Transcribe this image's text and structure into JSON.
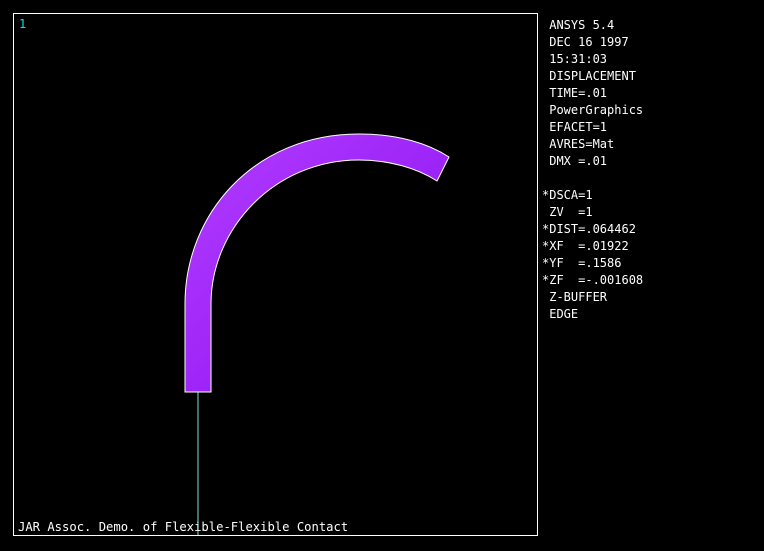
{
  "viewport": {
    "window_number": "1",
    "caption": "JAR Assoc. Demo. of Flexible-Flexible Contact"
  },
  "colors": {
    "background": "#000000",
    "frame": "#ffffff",
    "beam_fill": "#9a1aff",
    "beam_edge": "#ffffff",
    "target_line": "#7fe0e0",
    "window_number": "#00e5e5"
  },
  "legend": {
    "info": [
      " ANSYS 5.4",
      " DEC 16 1997",
      " 15:31:03",
      " DISPLACEMENT",
      " TIME=.01",
      " PowerGraphics",
      " EFACET=1",
      " AVRES=Mat",
      " DMX =.01"
    ],
    "view": [
      "*DSCA=1",
      " ZV  =1",
      "*DIST=.064462",
      "*XF  =.01922",
      "*YF  =.1586",
      "*ZF  =-.001608",
      " Z-BUFFER",
      " EDGE"
    ]
  }
}
